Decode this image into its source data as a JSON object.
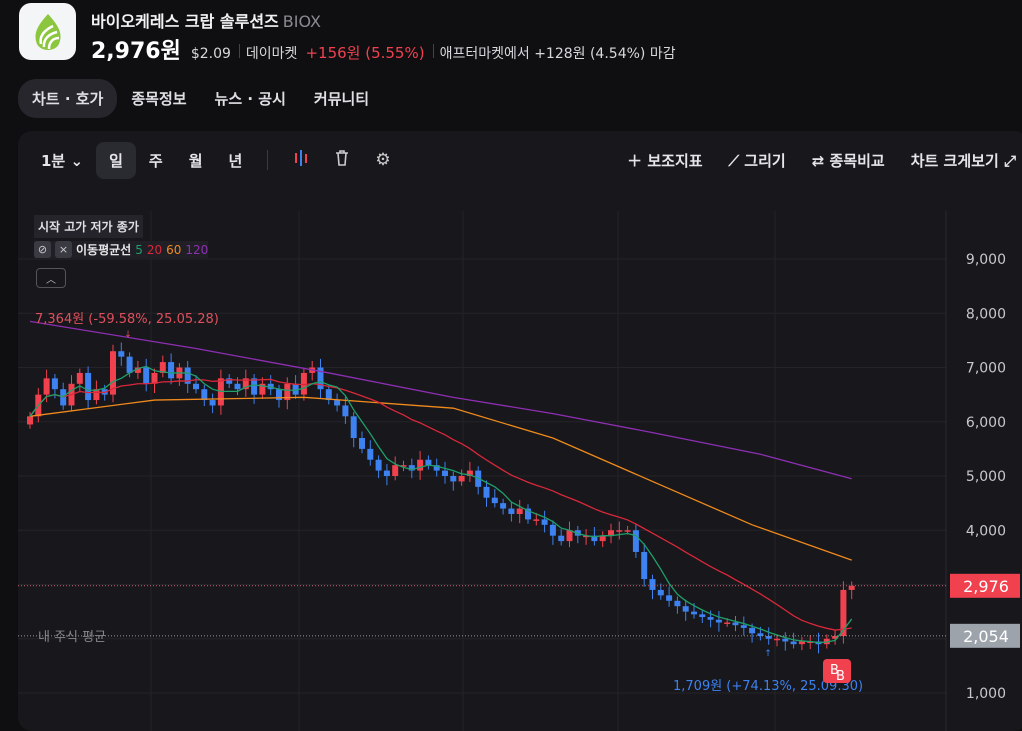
{
  "header": {
    "company": "바이오케레스 크랍 솔루션즈",
    "ticker": "BIOX",
    "price": "2,976원",
    "usd": "$2.09",
    "day_label": "데이마켓",
    "day_change": "+156원 (5.55%)",
    "after": "애프터마켓에서 +128원 (4.54%) 마감"
  },
  "tabs": [
    "차트 · 호가",
    "종목정보",
    "뉴스 · 공시",
    "커뮤니티"
  ],
  "toolbar": {
    "interval": "1분",
    "periods": [
      "일",
      "주",
      "월",
      "년"
    ],
    "indicator": "보조지표",
    "draw": "그리기",
    "compare": "종목비교",
    "expand": "차트 크게보기"
  },
  "legend": {
    "ohlc": "시작 고가 저가 종가",
    "ma_label": "이동평균선",
    "ma": [
      "5",
      "20",
      "60",
      "120"
    ]
  },
  "colors": {
    "up": "#f1414f",
    "down": "#3d82f0",
    "ma5": "#1fa06a",
    "ma20": "#d9283a",
    "ma60": "#f08a1c",
    "ma120": "#8e2fb3"
  },
  "chart_data": {
    "type": "candlestick",
    "ylim": [
      1000,
      9500
    ],
    "yticks": [
      "9,000",
      "8,000",
      "7,000",
      "6,000",
      "5,000",
      "4,000",
      "1,000"
    ],
    "ytick_values": [
      9000,
      8000,
      7000,
      6000,
      5000,
      4000,
      1000
    ],
    "closes": [
      6100,
      6500,
      6800,
      6600,
      6300,
      6700,
      6900,
      6400,
      6600,
      6500,
      7300,
      7200,
      6900,
      7000,
      6700,
      6900,
      7100,
      6800,
      7000,
      6700,
      6600,
      6400,
      6300,
      6800,
      6700,
      6600,
      6800,
      6500,
      6700,
      6600,
      6400,
      6700,
      6500,
      6900,
      7000,
      6600,
      6400,
      6300,
      6100,
      5700,
      5500,
      5300,
      5100,
      5000,
      5200,
      5200,
      5100,
      5300,
      5200,
      5100,
      5000,
      4900,
      5000,
      5100,
      4800,
      4600,
      4500,
      4400,
      4300,
      4400,
      4200,
      4200,
      4100,
      3900,
      3800,
      4000,
      3900,
      3900,
      3800,
      3900,
      4000,
      4000,
      4000,
      3600,
      3100,
      2900,
      2800,
      2700,
      2600,
      2500,
      2450,
      2400,
      2350,
      2300,
      2300,
      2250,
      2200,
      2100,
      2050,
      2000,
      2000,
      1950,
      1900,
      1950,
      1950,
      1900,
      2000,
      2050,
      2900,
      2976
    ],
    "ma60": [
      [
        0,
        6100
      ],
      [
        15,
        6400
      ],
      [
        33,
        6450
      ],
      [
        51,
        6250
      ],
      [
        63,
        5700
      ],
      [
        75,
        4900
      ],
      [
        87,
        4100
      ],
      [
        99,
        3450
      ]
    ],
    "ma120": [
      [
        0,
        7850
      ],
      [
        20,
        7350
      ],
      [
        36,
        6900
      ],
      [
        51,
        6450
      ],
      [
        63,
        6150
      ],
      [
        75,
        5800
      ],
      [
        88,
        5400
      ],
      [
        99,
        4950
      ]
    ],
    "current": {
      "value": 2976,
      "label": "2,976"
    },
    "avg": {
      "value": 2054,
      "label": "2,054",
      "text": "내 주식 평균"
    },
    "high_note": "7,364원 (-59.58%, 25.05.28)",
    "low_note": "1,709원 (+74.13%, 25.09.30)",
    "badge": "B"
  }
}
